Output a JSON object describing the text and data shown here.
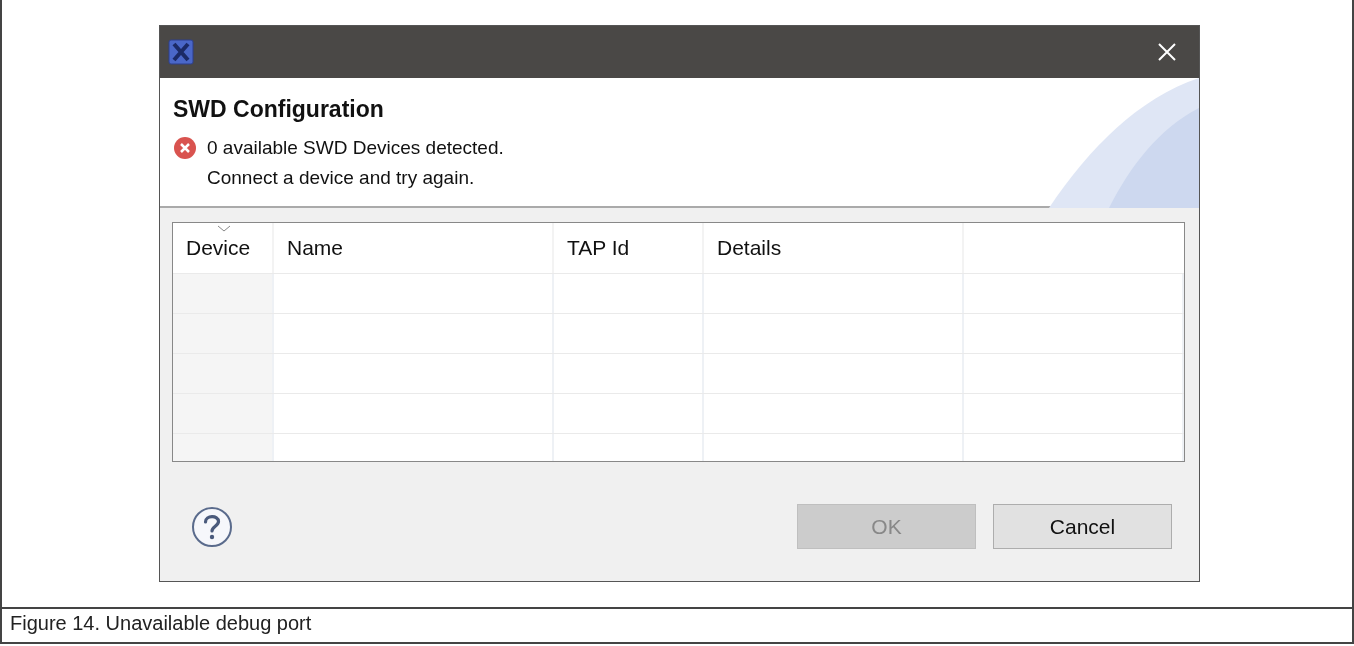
{
  "dialog": {
    "heading": "SWD Configuration",
    "messages": [
      {
        "kind": "error",
        "text": "0 available SWD Devices detected."
      },
      {
        "kind": "plain",
        "text": "Connect a device and try again."
      }
    ],
    "table": {
      "columns": [
        {
          "label": "Device",
          "sorted": true
        },
        {
          "label": "Name",
          "sorted": false
        },
        {
          "label": "TAP Id",
          "sorted": false
        },
        {
          "label": "Details",
          "sorted": false
        }
      ]
    },
    "buttons": [
      {
        "label": "OK",
        "disabled": true
      },
      {
        "label": "Cancel",
        "disabled": false
      }
    ]
  },
  "caption": "Figure 14.  Unavailable debug port"
}
